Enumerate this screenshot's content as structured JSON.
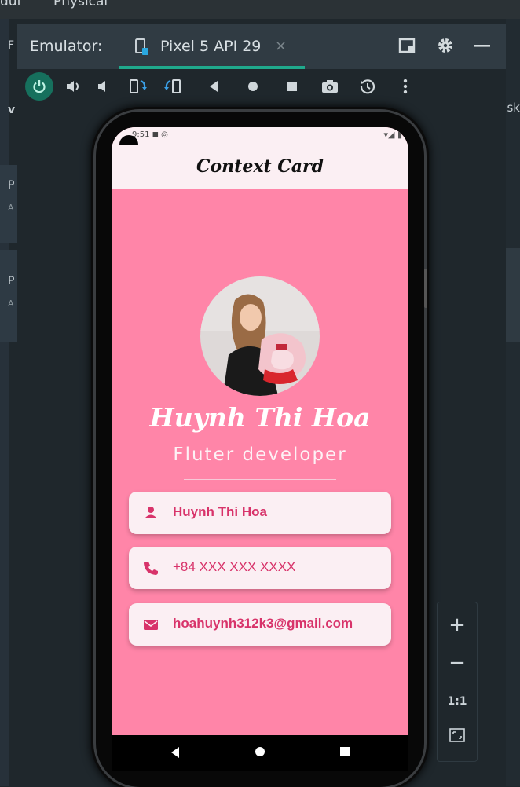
{
  "ide": {
    "top_text_left": "dul",
    "top_text_right": "Physical",
    "left_letters": [
      "F",
      "v",
      "P",
      "A",
      "P",
      "A"
    ],
    "right_text": "sk"
  },
  "emulator": {
    "label": "Emulator:",
    "tab_label": "Pixel 5 API 29",
    "tab_close": "×",
    "accent_color": "#1fa98c",
    "toolbar_icons": [
      "power-icon",
      "volume-up-icon",
      "volume-down-icon",
      "rotate-left-icon",
      "rotate-right-icon",
      "back-icon",
      "home-icon",
      "overview-icon",
      "screenshot-icon",
      "snapshot-icon",
      "more-icon"
    ]
  },
  "phone": {
    "status_time": "9:51",
    "app_title": "Context Card",
    "name": "Huynh Thi Hoa",
    "role": "Fluter developer",
    "cards": [
      {
        "icon": "person-icon",
        "text": "Huynh Thi Hoa"
      },
      {
        "icon": "phone-icon",
        "text": "+84 XXX XXX XXXX"
      },
      {
        "icon": "mail-icon",
        "text": "hoahuynh312k3@gmail.com"
      }
    ],
    "background_color": "#ff85a8",
    "text_accent": "#d8336a"
  },
  "zoom": {
    "plus": "+",
    "minus": "−",
    "reset": "1:1"
  }
}
